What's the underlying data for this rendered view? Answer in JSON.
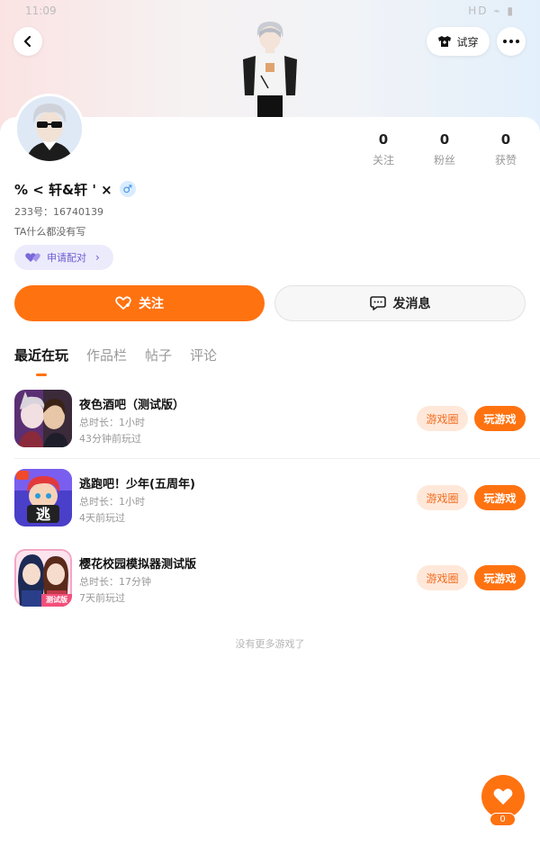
{
  "status_bar": {
    "time": "11:09",
    "indicators": "HD ⌁ ▮"
  },
  "header": {
    "back_icon": "back-arrow-icon",
    "try_on_label": "试穿",
    "try_on_icon": "shirt-icon",
    "more_icon": "more-dots-icon"
  },
  "profile": {
    "nickname": "% < 轩&轩 ' ×",
    "gender_symbol": "♂",
    "uid": "233号：16740139",
    "bio": "TA什么都没有写",
    "match_label": "申请配对",
    "stats": [
      {
        "value": "0",
        "label": "关注"
      },
      {
        "value": "0",
        "label": "粉丝"
      },
      {
        "value": "0",
        "label": "获赞"
      }
    ]
  },
  "actions": {
    "follow_label": "关注",
    "message_label": "发消息"
  },
  "tabs": [
    {
      "label": "最近在玩",
      "active": true
    },
    {
      "label": "作品栏",
      "active": false
    },
    {
      "label": "帖子",
      "active": false
    },
    {
      "label": "评论",
      "active": false
    }
  ],
  "games": [
    {
      "title": "夜色酒吧（测试版）",
      "duration": "总时长：1小时",
      "last_played": "43分钟前玩过",
      "circle_label": "游戏圈",
      "play_label": "玩游戏"
    },
    {
      "title": "逃跑吧！少年(五周年)",
      "duration": "总时长：1小时",
      "last_played": "4天前玩过",
      "circle_label": "游戏圈",
      "play_label": "玩游戏"
    },
    {
      "title": "樱花校园模拟器测试版",
      "duration": "总时长：17分钟",
      "last_played": "7天前玩过",
      "circle_label": "游戏圈",
      "play_label": "玩游戏"
    }
  ],
  "game_icon_texts": {
    "escape": "逃",
    "sakura": "测试版"
  },
  "no_more_text": "没有更多游戏了",
  "like": {
    "count": "0",
    "icon": "heart-icon"
  },
  "colors": {
    "accent": "#ff7210",
    "accent_light": "#ffe8d9",
    "match_purple": "#6d5bd0"
  }
}
